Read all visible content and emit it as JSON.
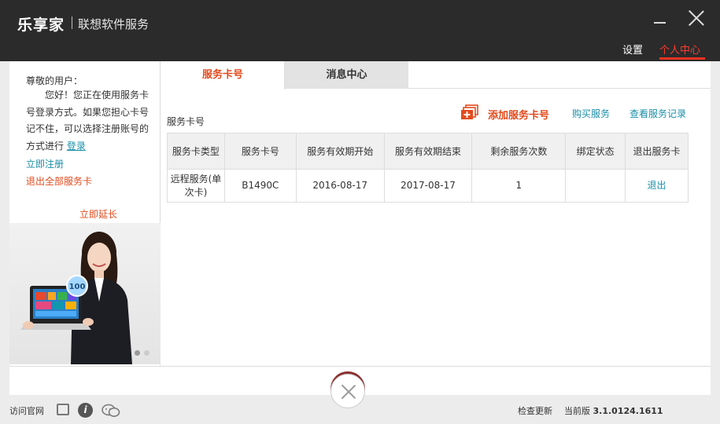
{
  "app": {
    "logo": "乐享家",
    "subtitle": "联想软件服务"
  },
  "nav": {
    "settings": "设置",
    "personal_center": "个人中心"
  },
  "sidebar": {
    "greeting_title": "尊敬的用户：",
    "greeting_body": "您好！您正在使用服务卡号登录方式。如果您担心卡号记不住，可以选择注册账号的方式进行 ",
    "login_link": "登录",
    "register_link": "立即注册",
    "exit_all_link": "退出全部服务卡",
    "extend_link": "立即延长",
    "promo_badge": "100"
  },
  "tabs": [
    {
      "label": "服务卡号"
    },
    {
      "label": "消息中心"
    }
  ],
  "main": {
    "section_label": "服务卡号",
    "actions": {
      "add_card": "添加服务卡号",
      "buy_service": "购买服务",
      "view_records": "查看服务记录"
    },
    "table": {
      "headers": [
        "服务卡类型",
        "服务卡号",
        "服务有效期开始",
        "服务有效期结束",
        "剩余服务次数",
        "绑定状态",
        "退出服务卡"
      ],
      "rows": [
        [
          "远程服务(单次卡)",
          "B1490C",
          "2016-08-17",
          "2017-08-17",
          "1",
          "",
          "退出"
        ]
      ]
    }
  },
  "footer": {
    "visit_site": "访问官网",
    "check_update": "检查更新",
    "version_label": "当前版",
    "version_value": "3.1.0124.1611"
  },
  "colors": {
    "accent": "#e24b1e",
    "link": "#1a8fa8",
    "titlebar": "#2b2b2b"
  }
}
